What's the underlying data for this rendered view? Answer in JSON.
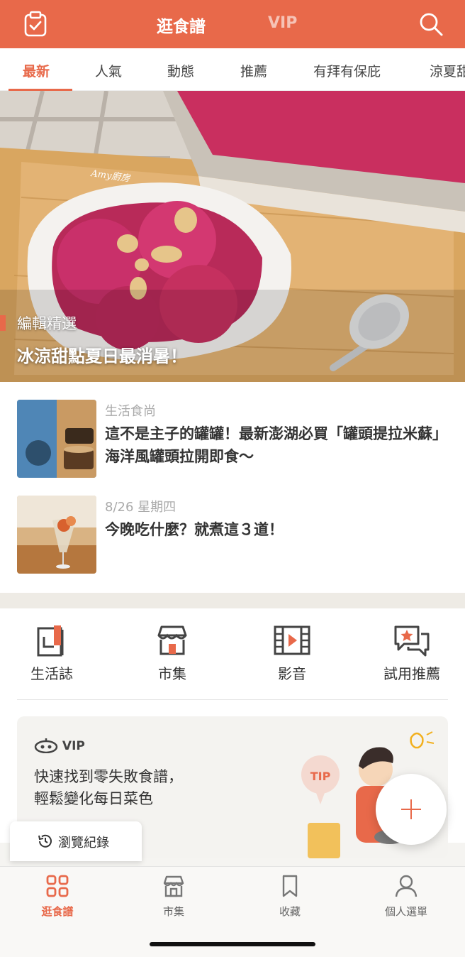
{
  "header": {
    "title": "逛食譜",
    "vip_tab": "VIP"
  },
  "tabs": [
    "最新",
    "人氣",
    "動態",
    "推薦",
    "有拜有保庇",
    "涼夏甜"
  ],
  "hero": {
    "label": "編輯精選",
    "title": "冰涼甜點夏日最消暑！",
    "watermark": "Amy廚房"
  },
  "articles": [
    {
      "category": "生活食尚",
      "title": "這不是主子的罐罐！最新澎湖必買「罐頭提拉米蘇」海洋風罐頭拉開即食～"
    },
    {
      "category": "8/26 星期四",
      "title": "今晚吃什麼？就煮這３道！"
    }
  ],
  "quick_links": [
    "生活誌",
    "市集",
    "影音",
    "試用推薦"
  ],
  "vip_card": {
    "badge": "VIP",
    "line1": "快速找到零失敗食譜，",
    "line2": "輕鬆變化每日菜色",
    "tip": "TIP"
  },
  "history_button": "瀏覽紀錄",
  "bottom_nav": [
    "逛食譜",
    "市集",
    "收藏",
    "個人選單"
  ],
  "colors": {
    "accent": "#e8694a"
  }
}
